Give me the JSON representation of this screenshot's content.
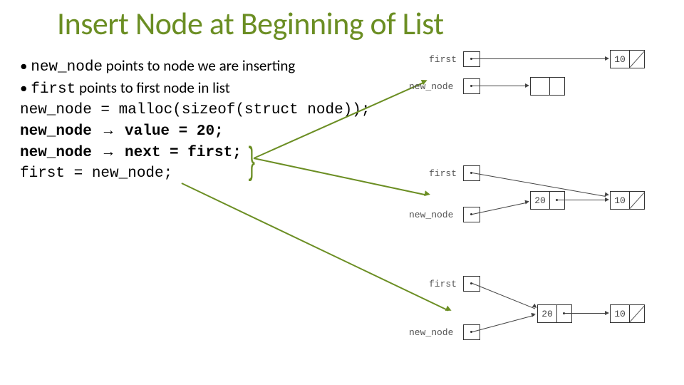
{
  "title": "Insert Node at Beginning of List",
  "bullets": [
    {
      "code": "new_node",
      "text": " points to node we are inserting"
    },
    {
      "code": "first",
      "text": " points to first node in list"
    }
  ],
  "code_lines": {
    "l1_a": "new_node = malloc(sizeof(struct node));",
    "l2_a": "new_node ",
    "l2_arrow": "→",
    "l2_b": " value = 20;",
    "l3_a": "new_node ",
    "l3_arrow": "→",
    "l3_b": " next = first;",
    "l4": "first = new_node;"
  },
  "diagram": {
    "labels": {
      "first": "first",
      "new_node": "new_node"
    },
    "values": {
      "ten": "10",
      "twenty": "20"
    }
  }
}
